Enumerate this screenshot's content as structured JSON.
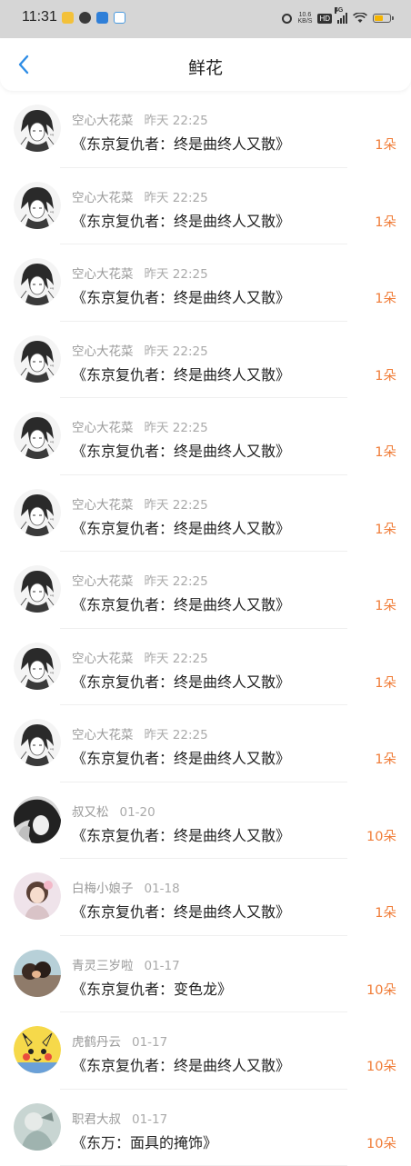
{
  "status_bar": {
    "time": "11:31",
    "net_speed_value": "10.6",
    "net_speed_unit": "KB/S",
    "hd": "HD",
    "network": "4G",
    "battery_level": 0.55,
    "battery_color": "#f5b400"
  },
  "nav": {
    "title": "鲜花",
    "back_icon": "chevron-left-icon"
  },
  "colors": {
    "accent": "#f07c37",
    "nav_back": "#2e8de6"
  },
  "gifts": [
    {
      "user": "空心大花菜",
      "time": "昨天 22:25",
      "work": "《东京复仇者：终是曲终人又散》",
      "count": "1朵"
    },
    {
      "user": "空心大花菜",
      "time": "昨天 22:25",
      "work": "《东京复仇者：终是曲终人又散》",
      "count": "1朵"
    },
    {
      "user": "空心大花菜",
      "time": "昨天 22:25",
      "work": "《东京复仇者：终是曲终人又散》",
      "count": "1朵"
    },
    {
      "user": "空心大花菜",
      "time": "昨天 22:25",
      "work": "《东京复仇者：终是曲终人又散》",
      "count": "1朵"
    },
    {
      "user": "空心大花菜",
      "time": "昨天 22:25",
      "work": "《东京复仇者：终是曲终人又散》",
      "count": "1朵"
    },
    {
      "user": "空心大花菜",
      "time": "昨天 22:25",
      "work": "《东京复仇者：终是曲终人又散》",
      "count": "1朵"
    },
    {
      "user": "空心大花菜",
      "time": "昨天 22:25",
      "work": "《东京复仇者：终是曲终人又散》",
      "count": "1朵"
    },
    {
      "user": "空心大花菜",
      "time": "昨天 22:25",
      "work": "《东京复仇者：终是曲终人又散》",
      "count": "1朵"
    },
    {
      "user": "空心大花菜",
      "time": "昨天 22:25",
      "work": "《东京复仇者：终是曲终人又散》",
      "count": "1朵"
    },
    {
      "user": "叔又松",
      "time": "01-20",
      "work": "《东京复仇者：终是曲终人又散》",
      "count": "10朵"
    },
    {
      "user": "白梅小娘子",
      "time": "01-18",
      "work": "《东京复仇者：终是曲终人又散》",
      "count": "1朵"
    },
    {
      "user": "青灵三岁啦",
      "time": "01-17",
      "work": "《东京复仇者：变色龙》",
      "count": "10朵"
    },
    {
      "user": "虎鹤丹云",
      "time": "01-17",
      "work": "《东京复仇者：终是曲终人又散》",
      "count": "10朵"
    },
    {
      "user": "职君大叔",
      "time": "01-17",
      "work": "《东万：面具的掩饰》",
      "count": "10朵"
    }
  ]
}
